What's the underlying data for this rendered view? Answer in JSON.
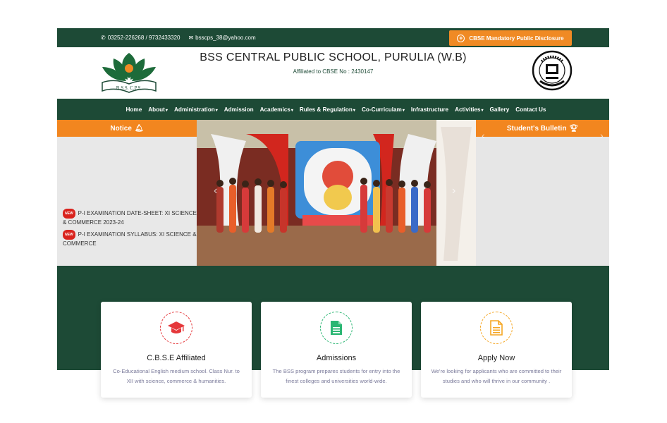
{
  "topbar": {
    "phone": "03252-226268 / 9732433320",
    "email": "bsscps_38@yahoo.com",
    "disclosure_label": "CBSE Mandatory Public Disclosure"
  },
  "header": {
    "school_name": "BSS CENTRAL PUBLIC SCHOOL, PURULIA (W.B)",
    "affiliation": "Affiliated to CBSE No : 2430147",
    "logo_text": "B.S.S.  C.P.S."
  },
  "nav": {
    "items": [
      {
        "label": "Home",
        "dropdown": false
      },
      {
        "label": "About",
        "dropdown": true
      },
      {
        "label": "Administration",
        "dropdown": true
      },
      {
        "label": "Admission",
        "dropdown": false
      },
      {
        "label": "Academics",
        "dropdown": true
      },
      {
        "label": "Rules & Regulation",
        "dropdown": true
      },
      {
        "label": "Co-Curriculam",
        "dropdown": true
      },
      {
        "label": "Infrastructure",
        "dropdown": false
      },
      {
        "label": "Activities",
        "dropdown": true
      },
      {
        "label": "Gallery",
        "dropdown": false
      },
      {
        "label": "Contact Us",
        "dropdown": false
      }
    ]
  },
  "notice": {
    "title": "Notice",
    "badge": "NEW",
    "items": [
      "P-I EXAMINATION DATE-SHEET: XI SCIENCE & COMMERCE 2023-24",
      "P-I EXAMINATION SYLLABUS: XI SCIENCE & COMMERCE"
    ]
  },
  "bulletin": {
    "title": "Student's Bulletin"
  },
  "cards": [
    {
      "title": "C.B.S.E Affiliated",
      "desc": "Co-Educational English medium school. Class Nur. to XII with science, commerce & humanities.",
      "icon": "graduation-cap-icon",
      "color": "#e5383b"
    },
    {
      "title": "Admissions",
      "desc": "The BSS program prepares students for entry into the finest colleges and universities world-wide.",
      "icon": "document-icon",
      "color": "#2bb673"
    },
    {
      "title": "Apply Now",
      "desc": "We're looking for applicants who are committed to their studies and who will thrive in our community .",
      "icon": "file-text-icon",
      "color": "#f5a623"
    }
  ],
  "colors": {
    "primary_green": "#1d4a36",
    "accent_orange": "#f2861f"
  }
}
